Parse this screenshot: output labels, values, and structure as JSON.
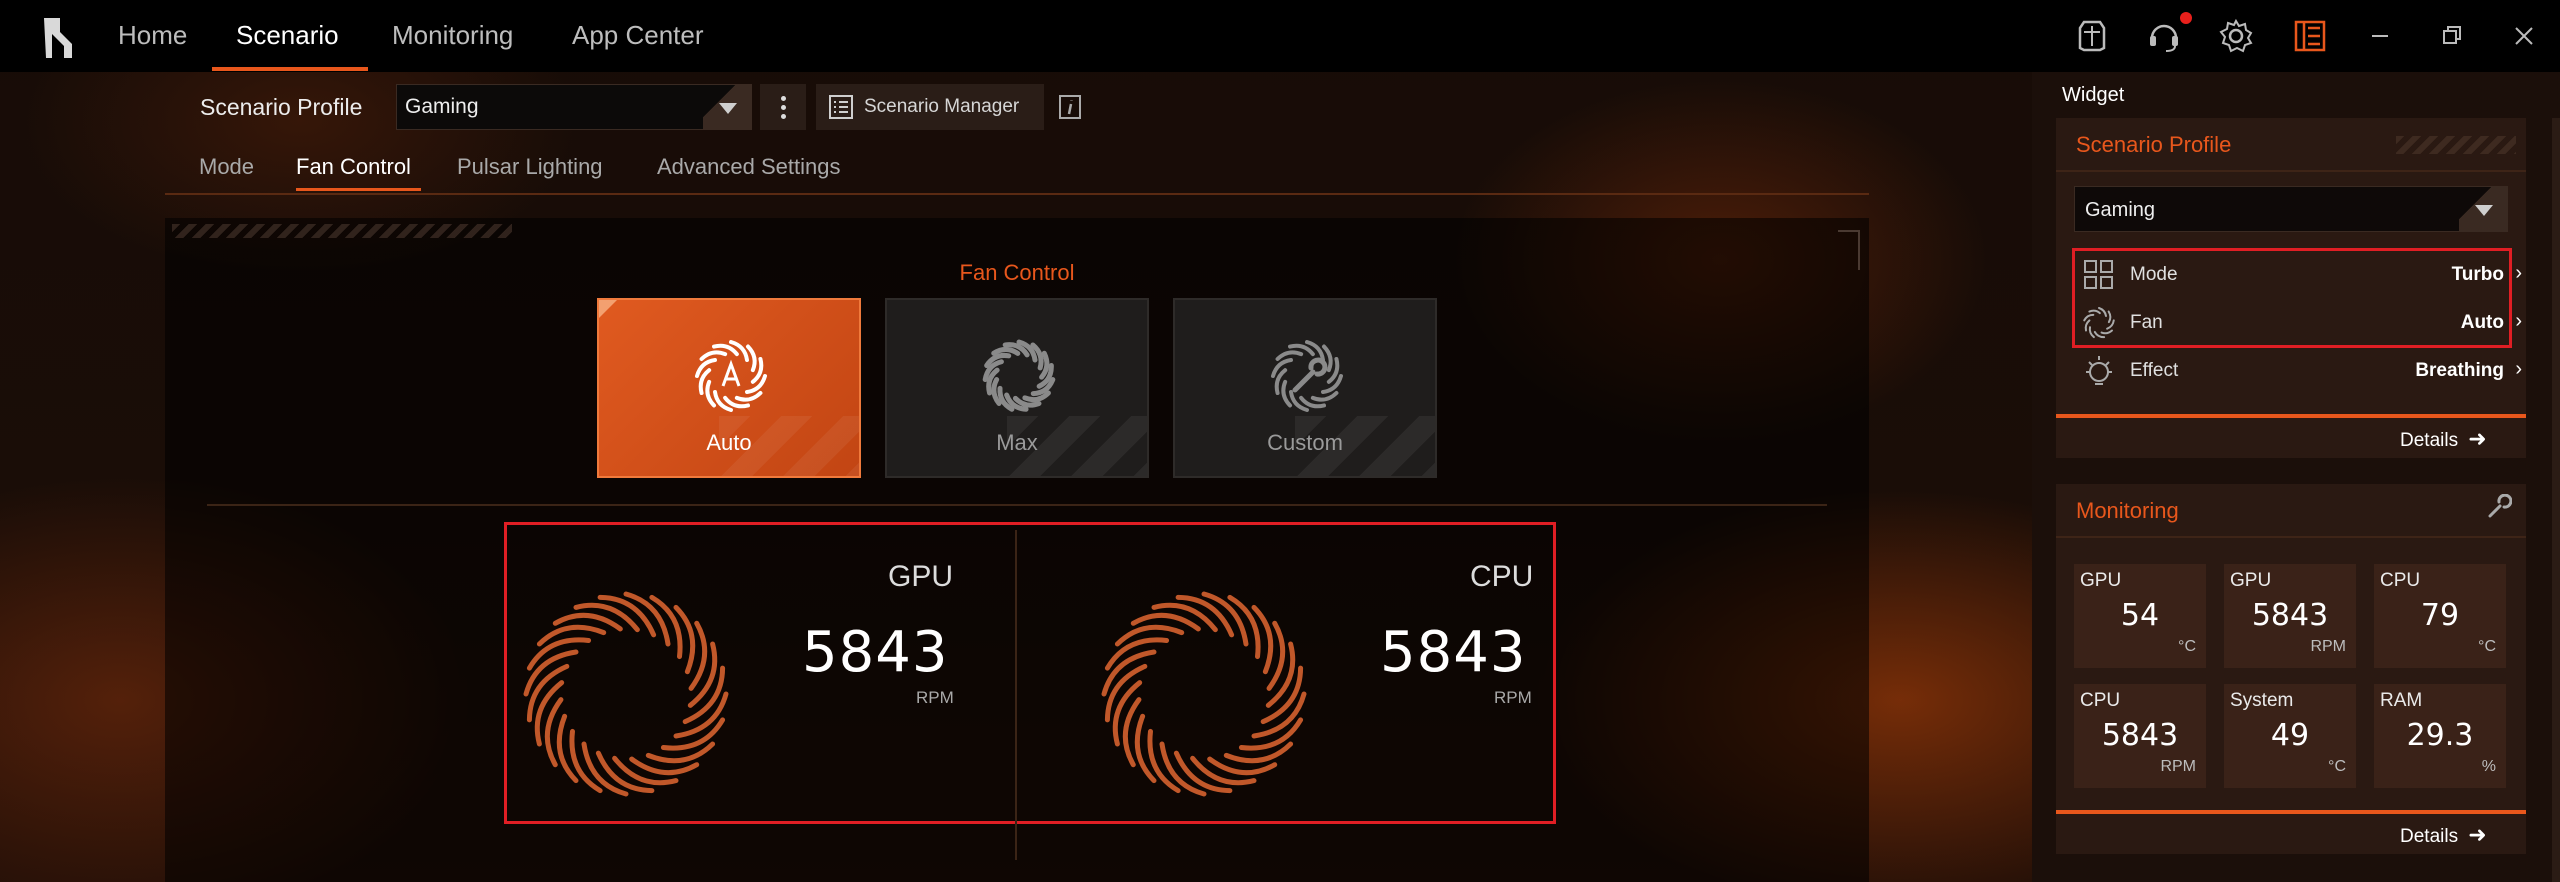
{
  "nav": {
    "tabs": [
      "Home",
      "Scenario",
      "Monitoring",
      "App Center"
    ],
    "active": "Scenario"
  },
  "scenario": {
    "profile_label": "Scenario Profile",
    "profile_value": "Gaming",
    "manager_label": "Scenario Manager"
  },
  "subtabs": [
    "Mode",
    "Fan Control",
    "Pulsar Lighting",
    "Advanced Settings"
  ],
  "fan_control": {
    "title": "Fan Control",
    "modes": [
      "Auto",
      "Max",
      "Custom"
    ],
    "selected_mode": "Auto",
    "gpu": {
      "name": "GPU",
      "rpm": "5843",
      "unit": "RPM"
    },
    "cpu": {
      "name": "CPU",
      "rpm": "5843",
      "unit": "RPM"
    }
  },
  "widget": {
    "title": "Widget",
    "scenario_card": {
      "title": "Scenario Profile",
      "profile_value": "Gaming",
      "rows": [
        {
          "label": "Mode",
          "value": "Turbo"
        },
        {
          "label": "Fan",
          "value": "Auto"
        },
        {
          "label": "Effect",
          "value": "Breathing"
        }
      ],
      "details": "Details"
    },
    "monitoring_card": {
      "title": "Monitoring",
      "tiles": [
        {
          "title": "GPU",
          "value": "54",
          "unit": "°C"
        },
        {
          "title": "GPU",
          "value": "5843",
          "unit": "RPM"
        },
        {
          "title": "CPU",
          "value": "79",
          "unit": "°C"
        },
        {
          "title": "CPU",
          "value": "5843",
          "unit": "RPM"
        },
        {
          "title": "System",
          "value": "49",
          "unit": "°C"
        },
        {
          "title": "RAM",
          "value": "29.3",
          "unit": "%"
        }
      ],
      "details": "Details"
    }
  },
  "colors": {
    "accent": "#e8571c",
    "highlight": "#e01e24"
  }
}
